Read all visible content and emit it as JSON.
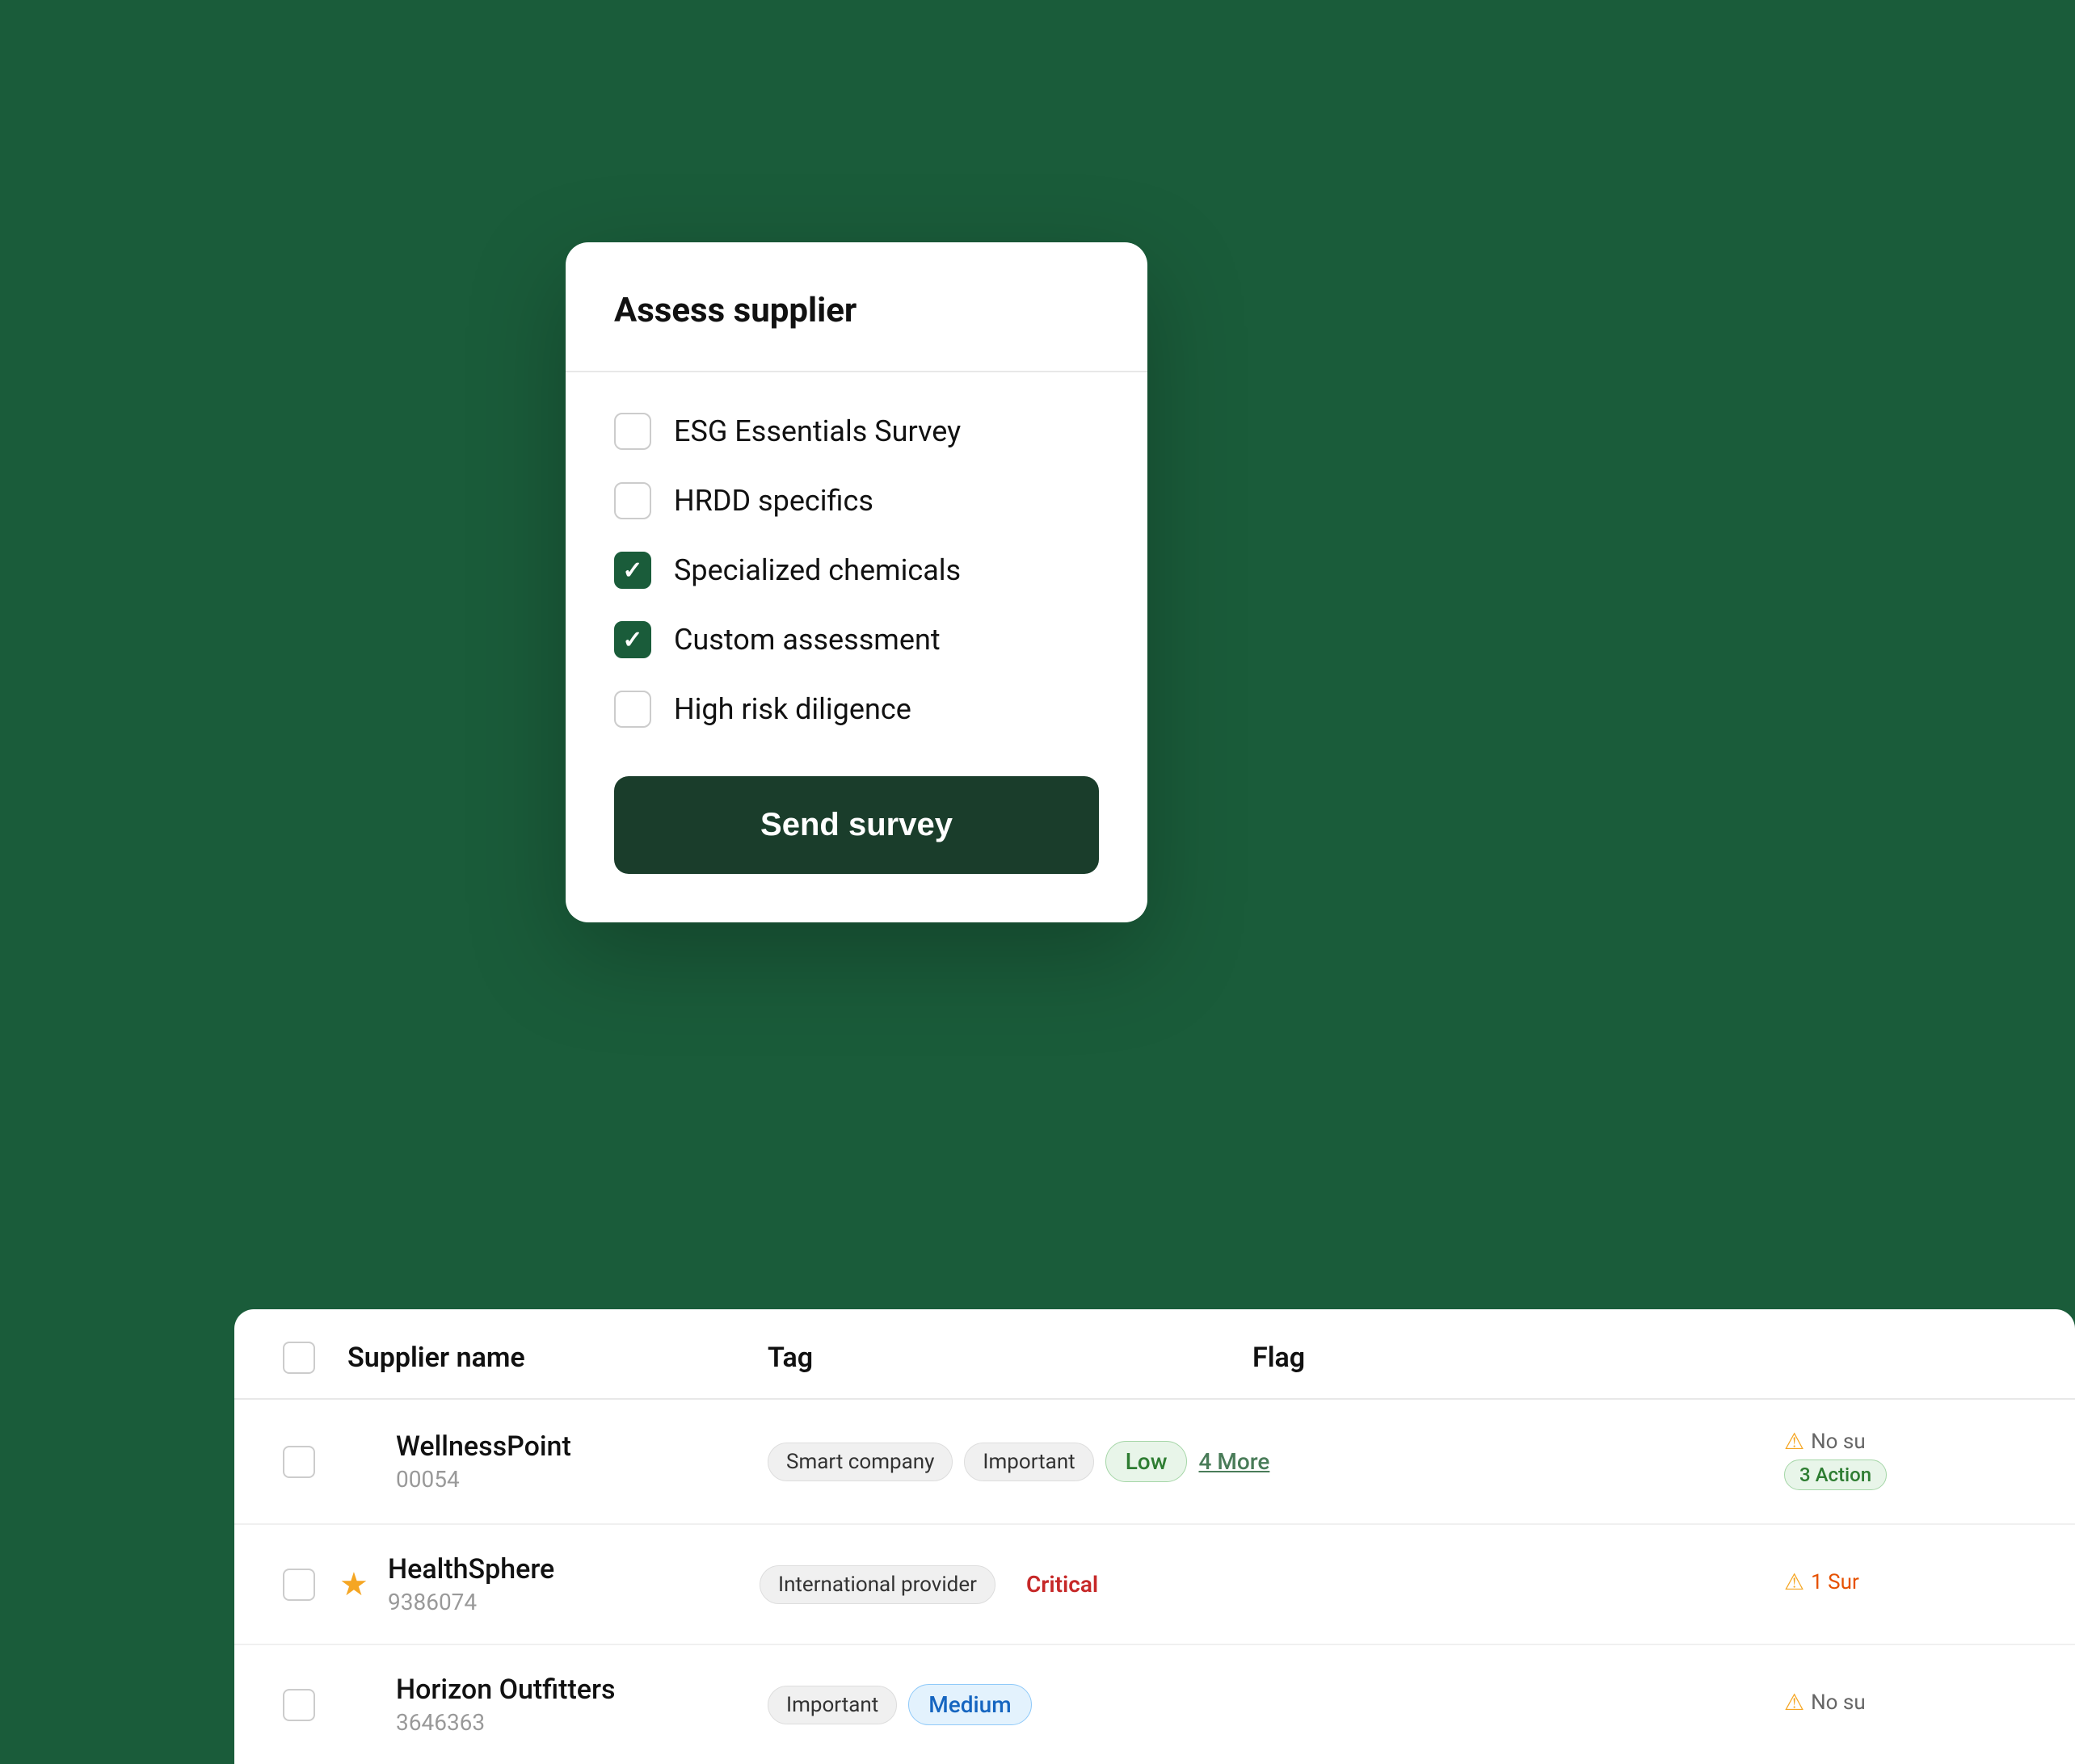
{
  "background": {
    "color": "#1a5c3a"
  },
  "modal": {
    "title": "Assess supplier",
    "options": [
      {
        "id": "esg",
        "label": "ESG Essentials Survey",
        "checked": false
      },
      {
        "id": "hrdd",
        "label": "HRDD specifics",
        "checked": false
      },
      {
        "id": "specialized",
        "label": "Specialized chemicals",
        "checked": true
      },
      {
        "id": "custom",
        "label": "Custom assessment",
        "checked": true
      },
      {
        "id": "highrisk",
        "label": "High risk diligence",
        "checked": false
      }
    ],
    "send_button_label": "Send survey"
  },
  "table": {
    "columns": {
      "supplier_name": "Supplier name",
      "tag": "Tag",
      "flag": "Flag"
    },
    "rows": [
      {
        "id": "wellnesspoint",
        "name": "WellnessPoint",
        "supplier_id": "00054",
        "starred": false,
        "tags": [
          "Smart company",
          "Important"
        ],
        "risk": "Low",
        "risk_type": "low",
        "more_label": "4 More",
        "flag_text": "No su",
        "flag_actions": "3 Action"
      },
      {
        "id": "healthsphere",
        "name": "HealthSphere",
        "supplier_id": "9386074",
        "starred": true,
        "tags": [
          "International provider"
        ],
        "risk": "Critical",
        "risk_type": "critical",
        "more_label": "",
        "flag_text": "1 Sur",
        "flag_actions": ""
      },
      {
        "id": "horizonoutfitters",
        "name": "Horizon Outfitters",
        "supplier_id": "3646363",
        "starred": false,
        "tags": [
          "Important"
        ],
        "risk": "Medium",
        "risk_type": "medium",
        "more_label": "",
        "flag_text": "No su",
        "flag_actions": ""
      }
    ]
  }
}
